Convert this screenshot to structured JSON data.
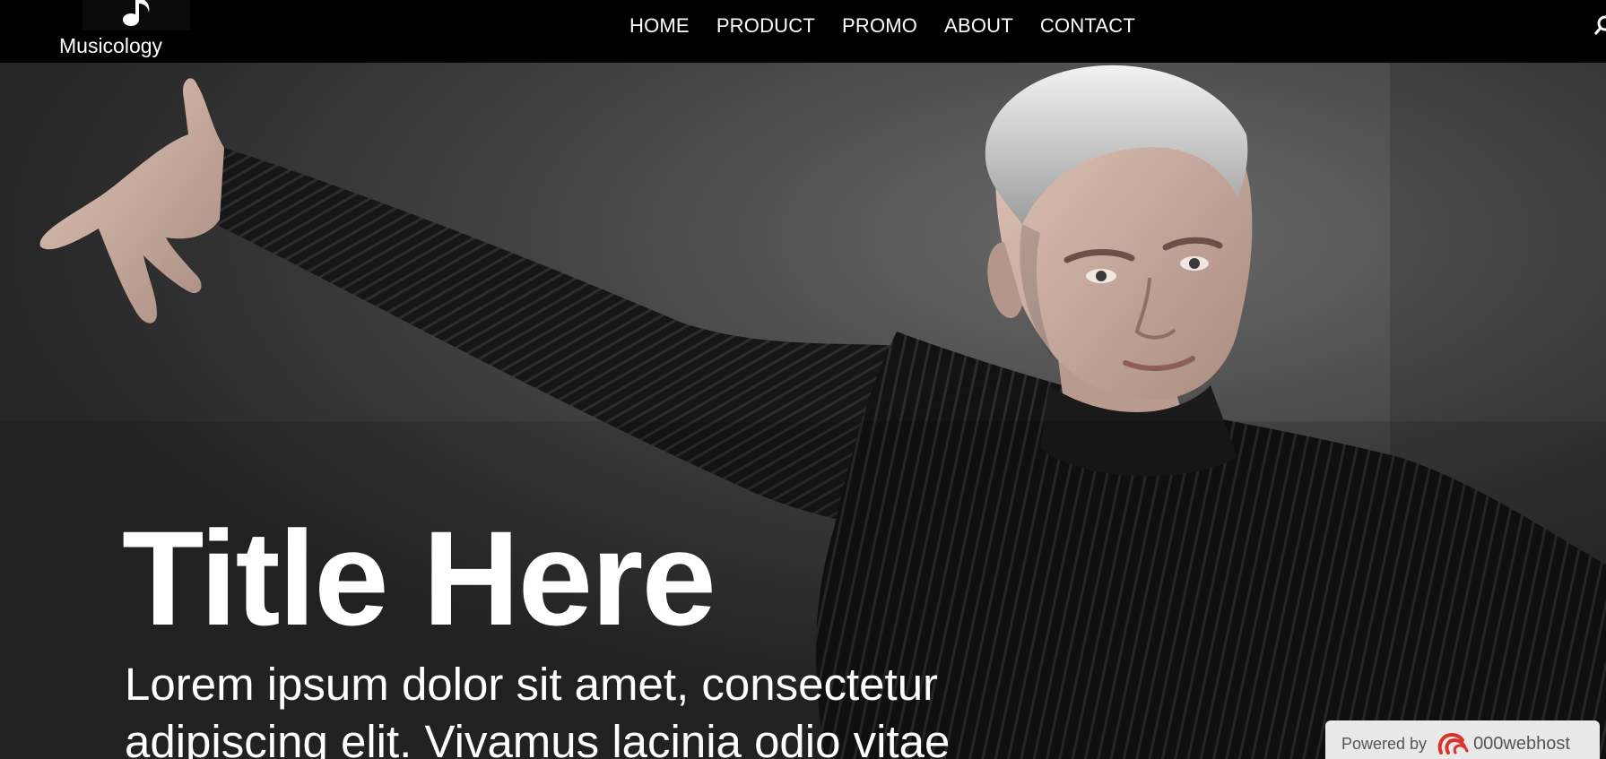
{
  "brand": {
    "name": "Musicology",
    "logo_icon": "music-note-icon"
  },
  "nav": {
    "items": [
      {
        "label": "HOME"
      },
      {
        "label": "PRODUCT"
      },
      {
        "label": "PROMO"
      },
      {
        "label": "ABOUT"
      },
      {
        "label": "CONTACT"
      }
    ],
    "search_icon": "search-icon"
  },
  "hero": {
    "title": "Title Here",
    "text_line1": "Lorem ipsum dolor sit amet, consectetur",
    "text_line2": "adipiscing elit. Vivamus lacinia odio vitae",
    "image": "man-in-black-turtleneck-photo"
  },
  "powered_badge": {
    "label": "Powered by",
    "brand": "000webhost",
    "icon": "000webhost-logo-icon"
  },
  "colors": {
    "navbar_bg": "#000000",
    "text": "#ffffff",
    "badge_bg": "#e9e9e9",
    "badge_logo": "#d9342b"
  }
}
